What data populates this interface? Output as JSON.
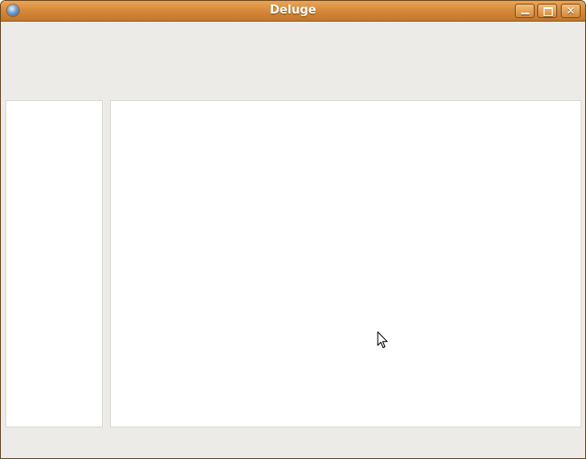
{
  "window": {
    "title": "Deluge",
    "app_icon": "deluge-icon",
    "buttons": {
      "minimize": "minimize-icon",
      "maximize": "maximize-icon",
      "close": "close-icon",
      "close_glyph": "✕"
    }
  },
  "colors": {
    "titlebar": "#d78a3a",
    "window_background": "#edebe7",
    "pane_background": "#ffffff"
  }
}
